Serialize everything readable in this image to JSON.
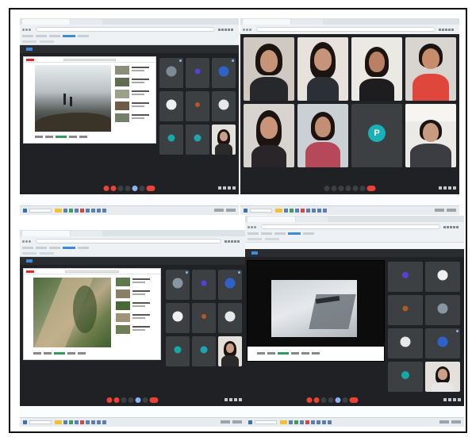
{
  "title": "",
  "screens": [
    {
      "id": "s1",
      "layout": "presentation",
      "browser": {
        "tabs": [
          "",
          ""
        ],
        "url": ""
      },
      "meeting": {
        "header": "",
        "time": ""
      },
      "presentation": {
        "content": "video"
      },
      "participants": [
        {
          "avatar_color": "#7d8b96"
        },
        {
          "avatar_color": "#5a3fd6"
        },
        {
          "avatar_color": "#2f62c9"
        },
        {
          "avatar_color": "#f0f0f0"
        },
        {
          "avatar_color": "#b0582a"
        },
        {
          "avatar_color": "#e8e8e8"
        },
        {
          "avatar_color": "#17a7a6"
        },
        {
          "avatar_color": "#1fa5b0"
        },
        {
          "avatar_color": "#caa08a",
          "camera": true
        }
      ]
    },
    {
      "id": "s2",
      "layout": "grid",
      "browser": {
        "tabs": [
          "",
          ""
        ],
        "url": ""
      },
      "meeting": {
        "header": "",
        "time": ""
      },
      "participants": [
        {
          "camera": true
        },
        {
          "camera": true
        },
        {
          "camera": true
        },
        {
          "camera": true
        },
        {
          "camera": true
        },
        {
          "camera": true
        },
        {
          "camera": false,
          "avatar_color": "#1ab0b8",
          "initial": "P"
        },
        {
          "camera": true
        }
      ]
    },
    {
      "id": "s3",
      "layout": "presentation",
      "browser": {
        "tabs": [
          "",
          ""
        ],
        "url": ""
      },
      "meeting": {
        "header": "",
        "time": ""
      },
      "presentation": {
        "content": "video"
      },
      "participants": [
        {
          "avatar_color": "#8696a3"
        },
        {
          "avatar_color": "#5a3fd6"
        },
        {
          "avatar_color": "#2f62c9"
        },
        {
          "avatar_color": "#f0f0f0"
        },
        {
          "avatar_color": "#b0582a"
        },
        {
          "avatar_color": "#e8e8e8"
        },
        {
          "avatar_color": "#17a7a6"
        },
        {
          "avatar_color": "#1fa5b0"
        },
        {
          "avatar_color": "#caa08a",
          "camera": true
        }
      ]
    },
    {
      "id": "s4",
      "layout": "presentation",
      "browser": {
        "tabs": [
          "",
          ""
        ],
        "url": ""
      },
      "meeting": {
        "header": "",
        "time": ""
      },
      "presentation": {
        "content": "video"
      },
      "participants": [
        {
          "avatar_color": "#5a3fd6"
        },
        {
          "avatar_color": "#f0f0f0"
        },
        {
          "avatar_color": "#b0582a"
        },
        {
          "avatar_color": "#8696a3"
        },
        {
          "avatar_color": "#e8e8e8"
        },
        {
          "avatar_color": "#2f62c9"
        },
        {
          "avatar_color": "#17a7a6"
        },
        {
          "avatar_color": "#caa08a",
          "camera": true
        }
      ]
    }
  ],
  "colors": {
    "meet_bg": "#202124",
    "tile_bg": "#3c4043",
    "end_call": "#ea4335",
    "accent": "#3d8bd8"
  }
}
